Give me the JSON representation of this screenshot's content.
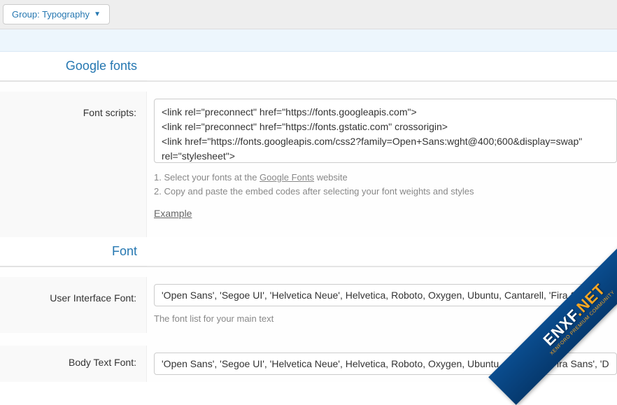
{
  "topbar": {
    "group_label": "Group: Typography"
  },
  "sections": {
    "google_fonts": {
      "title": "Google fonts",
      "font_scripts": {
        "label": "Font scripts:",
        "value": "<link rel=\"preconnect\" href=\"https://fonts.googleapis.com\">\n<link rel=\"preconnect\" href=\"https://fonts.gstatic.com\" crossorigin>\n<link href=\"https://fonts.googleapis.com/css2?family=Open+Sans:wght@400;600&display=swap\" rel=\"stylesheet\">",
        "hint_prefix": "1. Select your fonts at the ",
        "hint_link": "Google Fonts",
        "hint_suffix": " website",
        "hint_line2": "2. Copy and paste the embed codes after selecting your font weights and styles",
        "example_label": "Example"
      }
    },
    "font": {
      "title": "Font",
      "ui_font": {
        "label": "User Interface Font:",
        "value": "'Open Sans', 'Segoe UI', 'Helvetica Neue', Helvetica, Roboto, Oxygen, Ubuntu, Cantarell, 'Fira Sans', 'D",
        "hint": "The font list for your main text"
      },
      "body_font": {
        "label": "Body Text Font:",
        "value": "'Open Sans', 'Segoe UI', 'Helvetica Neue', Helvetica, Roboto, Oxygen, Ubuntu, Cantarell, 'Fira Sans', 'D"
      }
    }
  },
  "watermark": {
    "text_part1": "ENXF",
    "text_part2": ".NET",
    "subtext": "XENFORO PREMIUM COMMUNITY"
  }
}
